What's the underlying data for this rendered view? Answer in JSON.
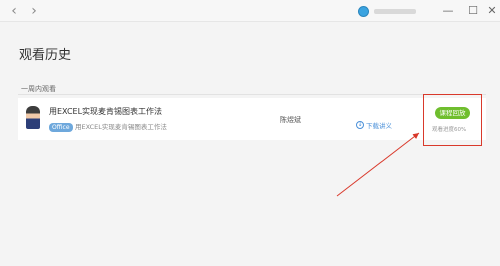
{
  "titlebar": {
    "back_icon": "chevron-left-icon",
    "forward_icon": "chevron-right-icon",
    "minimize_glyph": "—",
    "maximize_glyph": "☐",
    "close_glyph": "✕",
    "accent_color": "#3aa3e0"
  },
  "page": {
    "title": "观看历史",
    "section_label": "一周内观看"
  },
  "course": {
    "title": "用EXCEL实现麦肯锡图表工作法",
    "tag": "Office",
    "subtitle": "用EXCEL实现麦肯锡图表工作法",
    "teacher": "陈煜斌",
    "download_label": "下载讲义",
    "continue_label": "课程回放",
    "progress_text": "观看进度60%",
    "progress_value": 0.6,
    "button_color": "#6fbe2e",
    "highlight_color": "#d9392b"
  }
}
